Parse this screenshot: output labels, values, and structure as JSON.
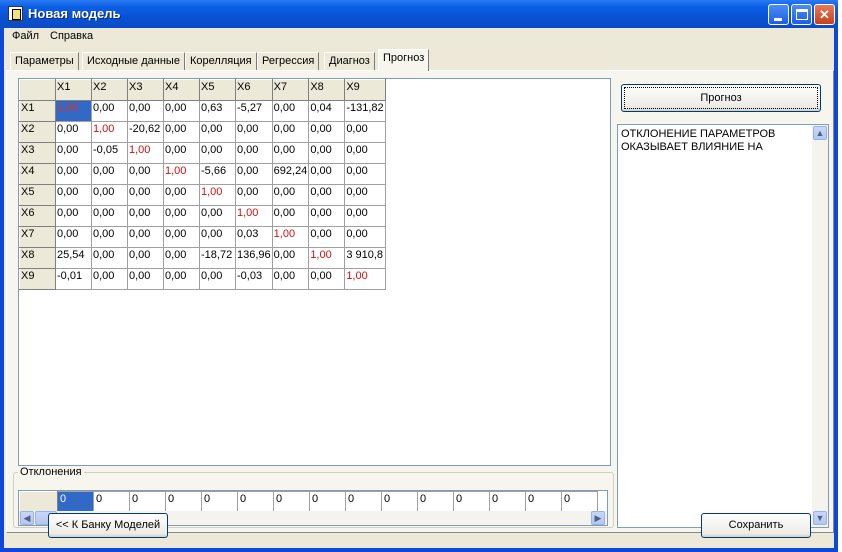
{
  "window": {
    "title": "Новая модель"
  },
  "menu": [
    "Файл",
    "Справка"
  ],
  "tabs": [
    "Параметры",
    "Исходные данные",
    "Корелляция",
    "Регрессия",
    "Диагноз",
    "Прогноз"
  ],
  "active_tab": "Прогноз",
  "grid": {
    "columns": [
      "",
      "X1",
      "X2",
      "X3",
      "X4",
      "X5",
      "X6",
      "X7",
      "X8",
      "X9"
    ],
    "rows": [
      {
        "label": "X1",
        "cells": [
          "1,00",
          "0,00",
          "0,00",
          "0,00",
          "0,63",
          "-5,27",
          "0,00",
          "0,04",
          "-131,82"
        ]
      },
      {
        "label": "X2",
        "cells": [
          "0,00",
          "1,00",
          "-20,62",
          "0,00",
          "0,00",
          "0,00",
          "0,00",
          "0,00",
          "0,00"
        ]
      },
      {
        "label": "X3",
        "cells": [
          "0,00",
          "-0,05",
          "1,00",
          "0,00",
          "0,00",
          "0,00",
          "0,00",
          "0,00",
          "0,00"
        ]
      },
      {
        "label": "X4",
        "cells": [
          "0,00",
          "0,00",
          "0,00",
          "1,00",
          "-5,66",
          "0,00",
          "692,24",
          "0,00",
          "0,00"
        ]
      },
      {
        "label": "X5",
        "cells": [
          "0,00",
          "0,00",
          "0,00",
          "0,00",
          "1,00",
          "0,00",
          "0,00",
          "0,00",
          "0,00"
        ]
      },
      {
        "label": "X6",
        "cells": [
          "0,00",
          "0,00",
          "0,00",
          "0,00",
          "0,00",
          "1,00",
          "0,00",
          "0,00",
          "0,00"
        ]
      },
      {
        "label": "X7",
        "cells": [
          "0,00",
          "0,00",
          "0,00",
          "0,00",
          "0,00",
          "0,03",
          "1,00",
          "0,00",
          "0,00"
        ]
      },
      {
        "label": "X8",
        "cells": [
          "25,54",
          "0,00",
          "0,00",
          "0,00",
          "-18,72",
          "136,96",
          "0,00",
          "1,00",
          "3 910,8"
        ]
      },
      {
        "label": "X9",
        "cells": [
          "-0,01",
          "0,00",
          "0,00",
          "0,00",
          "0,00",
          "-0,03",
          "0,00",
          "0,00",
          "1,00"
        ]
      }
    ],
    "diag_color": "#d01010"
  },
  "deviations": {
    "label": "Отклонения",
    "values": [
      "0",
      "0",
      "0",
      "0",
      "0",
      "0",
      "0",
      "0",
      "0",
      "0",
      "0",
      "0",
      "0",
      "0",
      "0"
    ]
  },
  "forecast_button": "Прогноз",
  "memo_text": "ОТКЛОНЕНИЕ ПАРАМЕТРОВ ОКАЗЫВАЕТ ВЛИЯНИЕ НА",
  "back_button": "<< К Банку Моделей",
  "save_button": "Сохранить",
  "colors": {
    "titlebar": "#0b5fe6",
    "selection": "#3169c6",
    "face": "#ece9d8"
  },
  "icons": [
    "app-icon",
    "minimize-icon",
    "maximize-icon",
    "close-icon",
    "scroll-left-icon",
    "scroll-right-icon",
    "scroll-up-icon",
    "scroll-down-icon"
  ]
}
